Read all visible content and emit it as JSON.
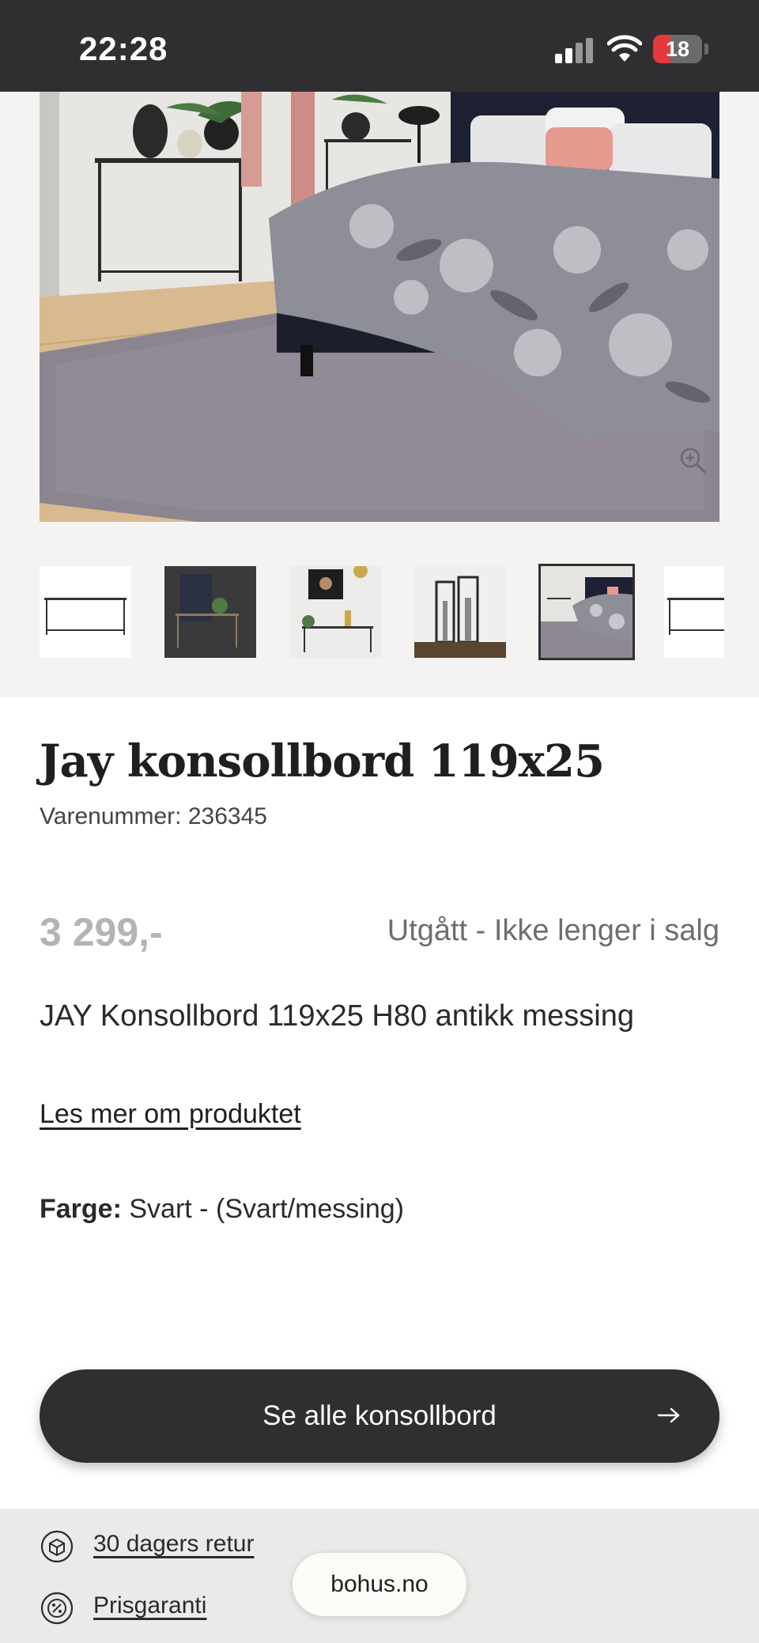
{
  "status_bar": {
    "time": "22:28",
    "battery_level": "18",
    "icons": [
      "signal-icon",
      "wifi-icon",
      "battery-icon"
    ]
  },
  "gallery": {
    "hero_alt": "bedroom-scene",
    "thumbnails": [
      {
        "name": "console-table-white-bg"
      },
      {
        "name": "console-table-dark-wall"
      },
      {
        "name": "console-table-portrait"
      },
      {
        "name": "console-table-lanterns"
      },
      {
        "name": "bedroom-scene",
        "active": true
      },
      {
        "name": "console-table-white-bg-2"
      }
    ]
  },
  "product": {
    "title": "Jay konsollbord 119x25",
    "sku": "Varenummer: 236345",
    "price": "3 299,-",
    "availability": "Utgått - Ikke lenger i salg",
    "description": "JAY Konsollbord 119x25 H80 antikk messing",
    "read_more": "Les mer om produktet",
    "color_label": "Farge:",
    "color_value": "Svart - (Svart/messing)"
  },
  "cta": {
    "label": "Se alle konsollbord"
  },
  "usps": [
    {
      "label": "30 dagers retur",
      "icon": "return-box-icon"
    },
    {
      "label": "Prisgaranti",
      "icon": "price-guarantee-icon"
    }
  ],
  "site_pill": "bohus.no",
  "colors": {
    "dark": "#2f2f32",
    "gallery_bg": "#f4f3f1",
    "footer_bg": "#e9ebe8",
    "price_grey": "#b4b4b7"
  }
}
